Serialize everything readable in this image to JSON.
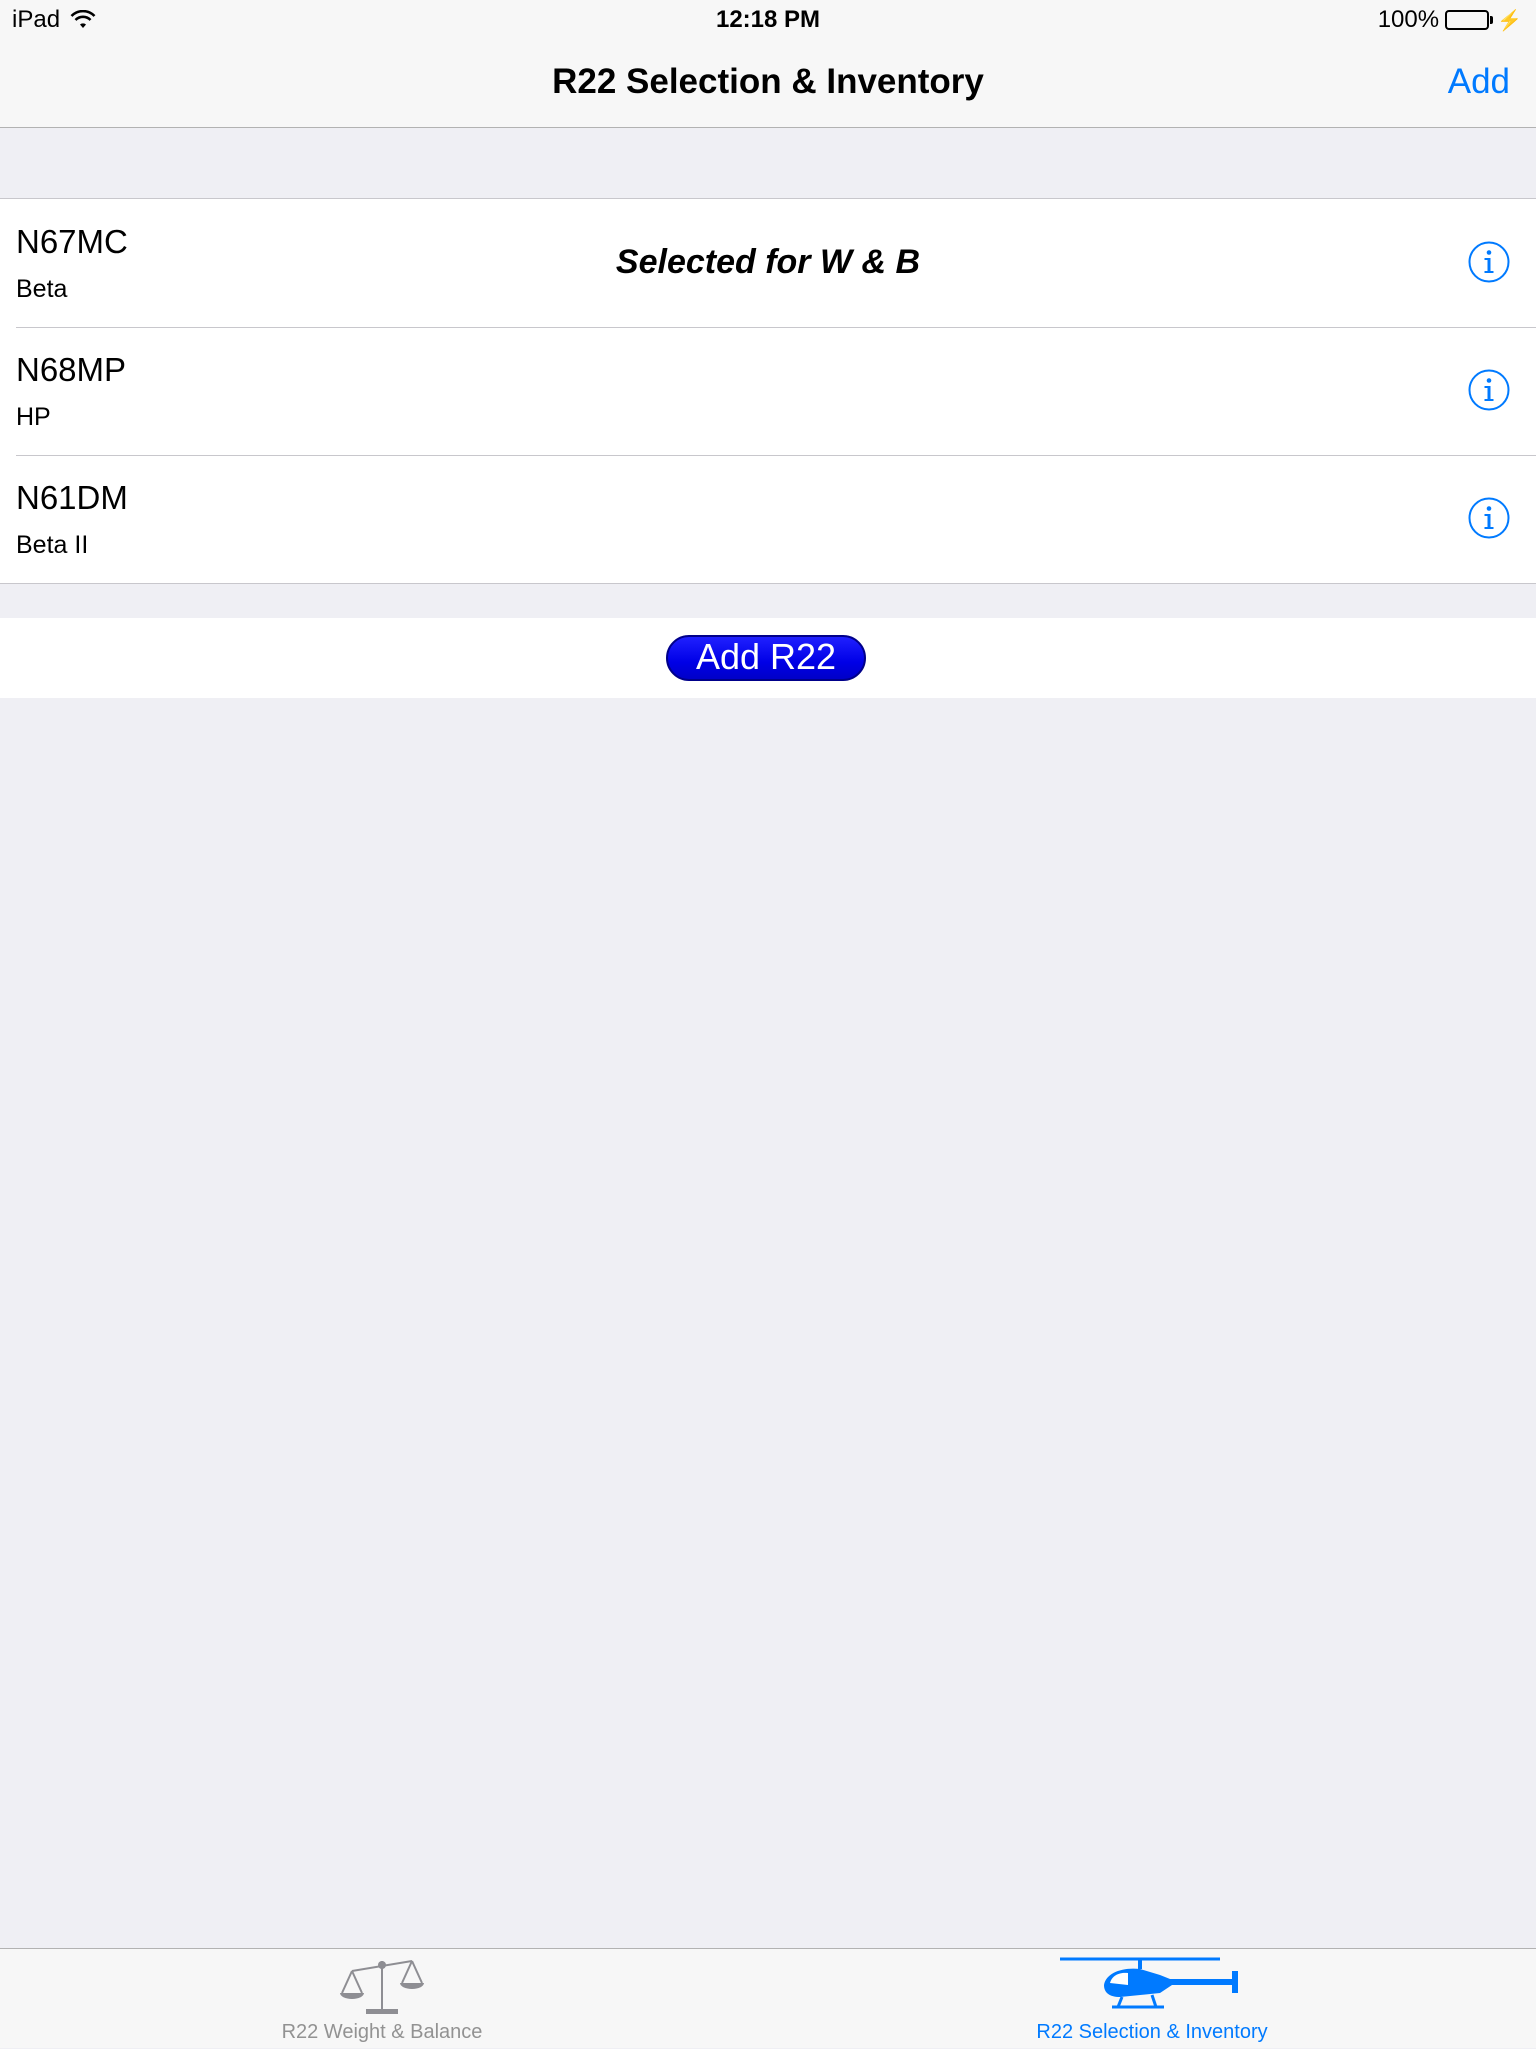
{
  "status_bar": {
    "device": "iPad",
    "time": "12:18 PM",
    "battery": "100%"
  },
  "nav": {
    "title": "R22 Selection & Inventory",
    "add_label": "Add"
  },
  "aircraft": [
    {
      "tail": "N67MC",
      "model": "Beta",
      "selected_label": "Selected for W & B"
    },
    {
      "tail": "N68MP",
      "model": "HP"
    },
    {
      "tail": "N61DM",
      "model": "Beta II"
    }
  ],
  "add_button": "Add R22",
  "tabs": [
    {
      "label": "R22 Weight & Balance",
      "icon": "scale-icon",
      "active": false
    },
    {
      "label": "R22 Selection & Inventory",
      "icon": "helicopter-icon",
      "active": true
    }
  ],
  "colors": {
    "accent": "#007aff",
    "add_button": "#0000e6",
    "battery": "#4cd964",
    "tab_inactive": "#929292"
  }
}
